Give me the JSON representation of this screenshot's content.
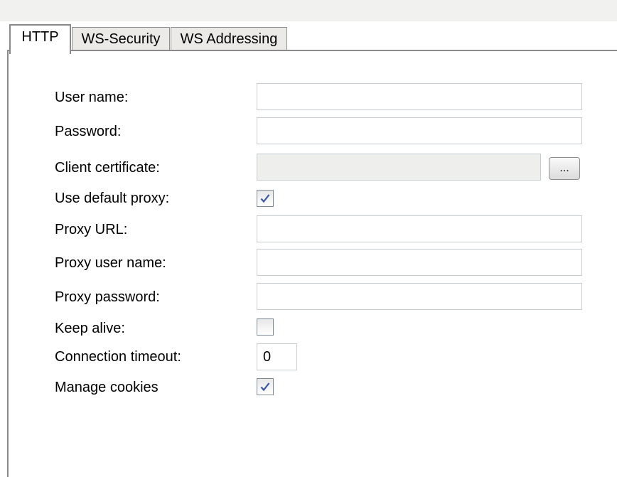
{
  "tabs": [
    {
      "label": "HTTP",
      "active": true
    },
    {
      "label": "WS-Security",
      "active": false
    },
    {
      "label": "WS Addressing",
      "active": false
    }
  ],
  "form": {
    "user_name_label": "User name:",
    "user_name_value": "",
    "password_label": "Password:",
    "password_value": "",
    "client_certificate_label": "Client certificate:",
    "client_certificate_value": "",
    "browse_button_label": "...",
    "use_default_proxy_label": "Use default proxy:",
    "use_default_proxy_checked": true,
    "proxy_url_label": "Proxy URL:",
    "proxy_url_value": "",
    "proxy_user_name_label": "Proxy user name:",
    "proxy_user_name_value": "",
    "proxy_password_label": "Proxy password:",
    "proxy_password_value": "",
    "keep_alive_label": "Keep alive:",
    "keep_alive_checked": false,
    "connection_timeout_label": "Connection timeout:",
    "connection_timeout_value": "0",
    "manage_cookies_label": "Manage cookies",
    "manage_cookies_checked": true
  },
  "colors": {
    "checkmark": "#3657a8",
    "tab_border": "#8a8a8a",
    "field_border": "#c7ccd1"
  }
}
